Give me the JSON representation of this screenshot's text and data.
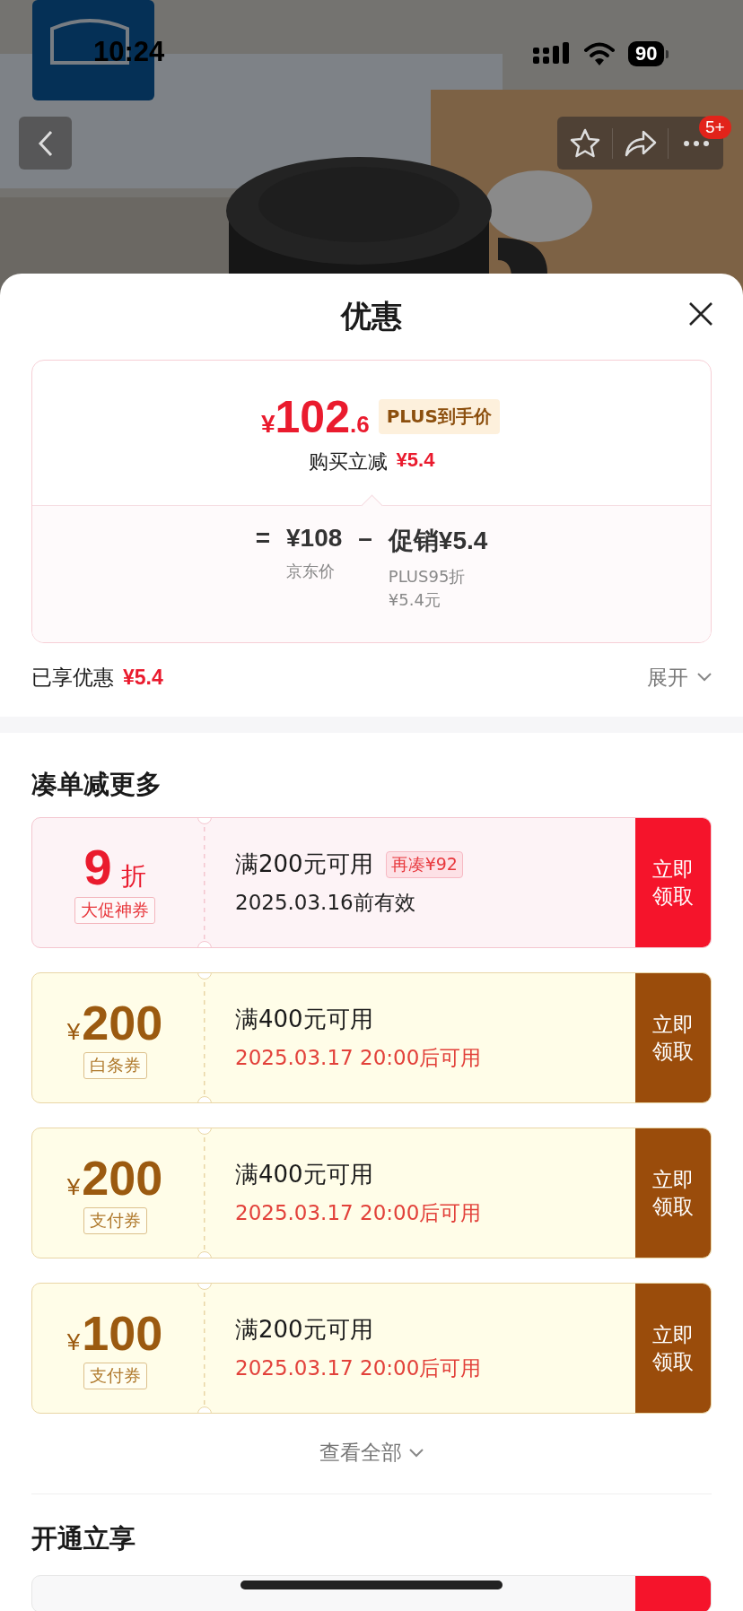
{
  "status_bar": {
    "time": "10:24",
    "battery": "90"
  },
  "nav": {
    "badge": "5+"
  },
  "sheet": {
    "title": "优惠"
  },
  "price_card": {
    "currency": "¥",
    "price_integer": "102",
    "price_decimal": ".6",
    "price_tag": "PLUS到手价",
    "instant_label": "购买立减",
    "instant_amount": "¥5.4",
    "formula": [
      {
        "kind": "sign",
        "value": "="
      },
      {
        "kind": "term",
        "value": "¥108",
        "notes": [
          "京东价"
        ]
      },
      {
        "kind": "sign",
        "value": "–"
      },
      {
        "kind": "term",
        "value": "促销¥5.4",
        "notes": [
          "PLUS95折",
          "¥5.4元"
        ]
      }
    ]
  },
  "savings": {
    "label": "已享优惠",
    "amount": "¥5.4",
    "toggle": "展开"
  },
  "bundle_section": {
    "title": "凑单减更多",
    "coupons": [
      {
        "kind": "discount",
        "value": "9",
        "unit": "折",
        "tag": "大促神券",
        "condition": "满200元可用",
        "hint": "再凑¥92",
        "validity": "2025.03.16前有效",
        "action": "立即领取"
      },
      {
        "kind": "amount",
        "unit": "¥",
        "value": "200",
        "tag": "白条券",
        "condition": "满400元可用",
        "validity": "2025.03.17 20:00后可用",
        "action": "立即领取"
      },
      {
        "kind": "amount",
        "unit": "¥",
        "value": "200",
        "tag": "支付券",
        "condition": "满400元可用",
        "validity": "2025.03.17 20:00后可用",
        "action": "立即领取"
      },
      {
        "kind": "amount",
        "unit": "¥",
        "value": "100",
        "tag": "支付券",
        "condition": "满200元可用",
        "validity": "2025.03.17 20:00后可用",
        "action": "立即领取"
      }
    ],
    "view_all": "查看全部"
  },
  "member_section": {
    "title": "开通立享"
  }
}
